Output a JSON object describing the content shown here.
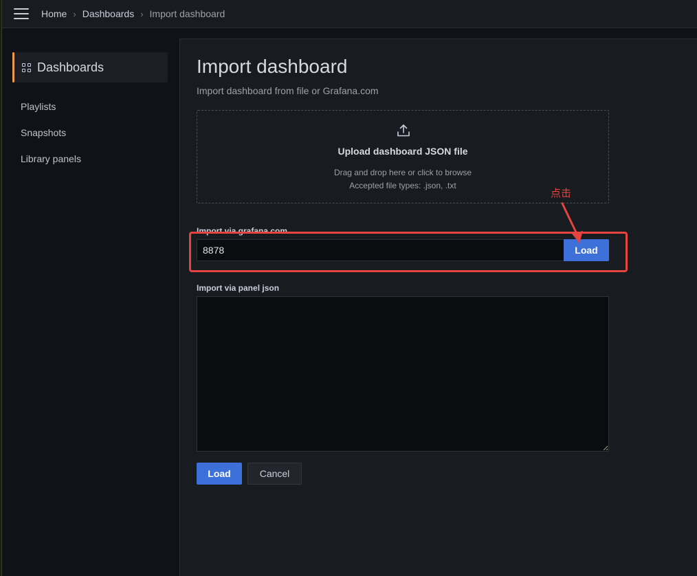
{
  "topbar": {
    "breadcrumbs": [
      "Home",
      "Dashboards",
      "Import dashboard"
    ]
  },
  "sidebar": {
    "header": "Dashboards",
    "items": [
      {
        "label": "Playlists"
      },
      {
        "label": "Snapshots"
      },
      {
        "label": "Library panels"
      }
    ]
  },
  "main": {
    "title": "Import dashboard",
    "subtitle": "Import dashboard from file or Grafana.com",
    "upload": {
      "title": "Upload dashboard JSON file",
      "line1": "Drag and drop here or click to browse",
      "line2": "Accepted file types: .json, .txt"
    },
    "grafana_com": {
      "label": "Import via grafana.com",
      "value": "8878",
      "button": "Load"
    },
    "panel_json": {
      "label": "Import via panel json",
      "value": ""
    },
    "actions": {
      "load": "Load",
      "cancel": "Cancel"
    }
  },
  "annotation": {
    "text": "点击",
    "color": "#e5443f"
  },
  "colors": {
    "accent": "#f2994a",
    "primary": "#3d71d9",
    "background": "#111217",
    "panel": "#181b1f"
  }
}
